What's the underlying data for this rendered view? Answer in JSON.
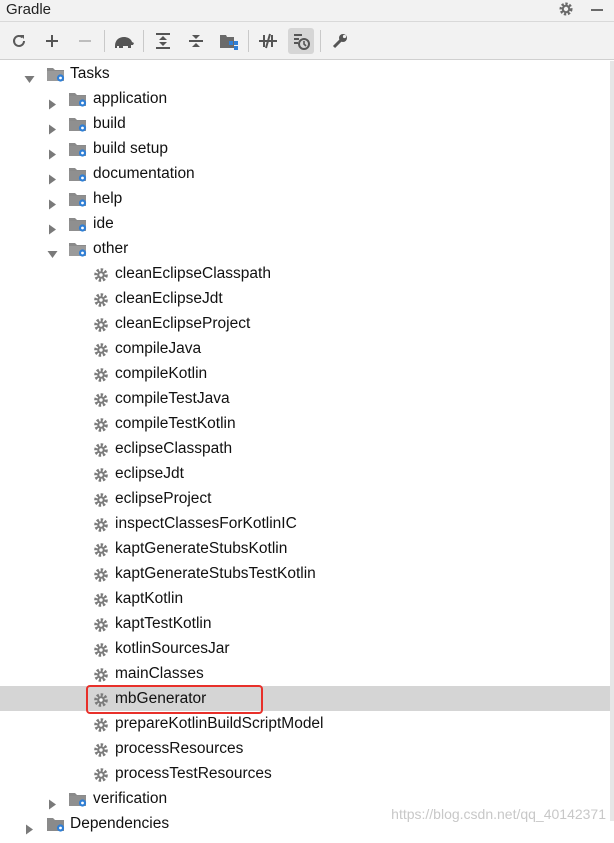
{
  "window": {
    "title": "Gradle"
  },
  "toolbar": {
    "buttons": [
      {
        "icon": "refresh-icon"
      },
      {
        "icon": "plus-icon"
      },
      {
        "icon": "minus-icon"
      },
      {
        "icon": "elephant-icon"
      },
      {
        "icon": "expand-all-icon"
      },
      {
        "icon": "collapse-all-icon"
      },
      {
        "icon": "group-modules-icon"
      },
      {
        "icon": "toggle-offline-icon"
      },
      {
        "icon": "show-tasks-icon"
      },
      {
        "icon": "wrench-icon"
      }
    ]
  },
  "tree": {
    "tasks_label": "Tasks",
    "groups": [
      "application",
      "build",
      "build setup",
      "documentation",
      "help",
      "ide"
    ],
    "other_label": "other",
    "other_tasks": [
      "cleanEclipseClasspath",
      "cleanEclipseJdt",
      "cleanEclipseProject",
      "compileJava",
      "compileKotlin",
      "compileTestJava",
      "compileTestKotlin",
      "eclipseClasspath",
      "eclipseJdt",
      "eclipseProject",
      "inspectClassesForKotlinIC",
      "kaptGenerateStubsKotlin",
      "kaptGenerateStubsTestKotlin",
      "kaptKotlin",
      "kaptTestKotlin",
      "kotlinSourcesJar",
      "mainClasses",
      "mbGenerator",
      "prepareKotlinBuildScriptModel",
      "processResources",
      "processTestResources"
    ],
    "selected_task": "mbGenerator",
    "verification_label": "verification",
    "dependencies_label": "Dependencies"
  },
  "watermark": "https://blog.csdn.net/qq_40142371",
  "colors": {
    "selection": "#d5d5d5",
    "highlight_box": "#e8302a",
    "icon_blue": "#2f7fd6",
    "icon_gray": "#7b7b7b"
  }
}
